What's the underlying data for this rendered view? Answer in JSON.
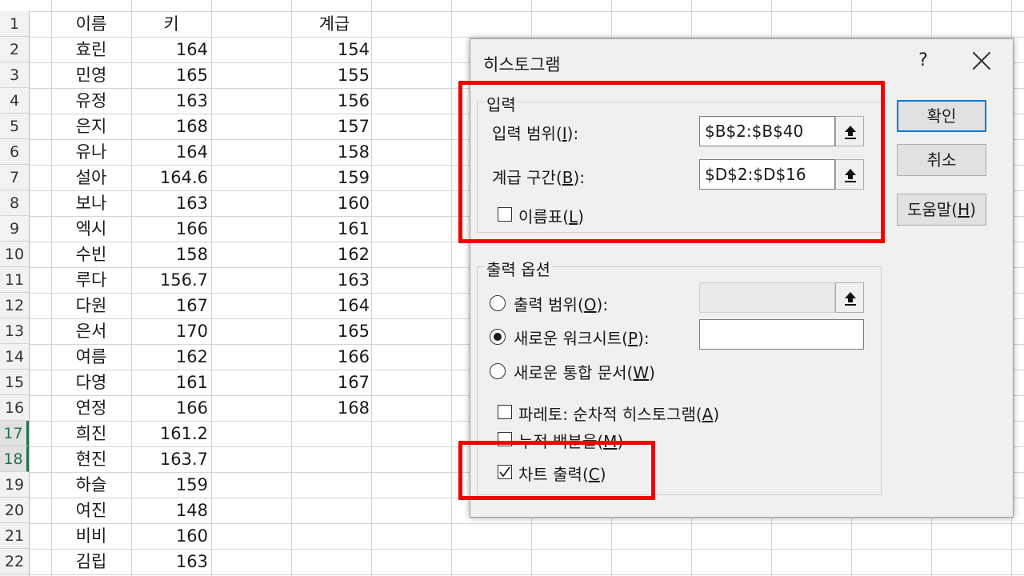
{
  "sheet": {
    "headers": {
      "name": "이름",
      "height": "키",
      "bin": "계급"
    },
    "row_numbers": [
      "1",
      "2",
      "3",
      "4",
      "5",
      "6",
      "7",
      "8",
      "9",
      "10",
      "11",
      "12",
      "13",
      "14",
      "15",
      "16",
      "17",
      "18",
      "19",
      "20",
      "21",
      "22"
    ],
    "names": [
      "효린",
      "민영",
      "유정",
      "은지",
      "유나",
      "설아",
      "보나",
      "엑시",
      "수빈",
      "루다",
      "다원",
      "은서",
      "여름",
      "다영",
      "연정",
      "희진",
      "현진",
      "하슬",
      "여진",
      "비비",
      "김립"
    ],
    "heights": [
      "164",
      "165",
      "163",
      "168",
      "164",
      "164.6",
      "163",
      "166",
      "158",
      "156.7",
      "167",
      "170",
      "162",
      "161",
      "166",
      "161.2",
      "163.7",
      "159",
      "148",
      "160",
      "163"
    ],
    "bins": [
      "154",
      "155",
      "156",
      "157",
      "158",
      "159",
      "160",
      "161",
      "162",
      "163",
      "164",
      "165",
      "166",
      "167",
      "168"
    ]
  },
  "dialog": {
    "title": "히스토그램",
    "help": "?",
    "input_group": {
      "label": "입력",
      "input_range_label": "입력 범위(I):",
      "input_range_value": "$B$2:$B$40",
      "bin_range_label": "계급 구간(B):",
      "bin_range_value": "$D$2:$D$16",
      "labels_checkbox": "이름표(L)"
    },
    "output_group": {
      "label": "출력 옵션",
      "output_range": "출력 범위(O):",
      "new_worksheet": "새로운 워크시트(P):",
      "new_workbook": "새로운 통합 문서(W)",
      "pareto": "파레토: 순차적 히스토그램(A)",
      "cumulative": "누적 백분율(M)",
      "chart_output": "차트 출력(C)",
      "selected_output": "new_worksheet"
    },
    "buttons": {
      "ok": "확인",
      "cancel": "취소",
      "help": "도움말(H)"
    },
    "checked": {
      "labels": false,
      "pareto": false,
      "cumulative": false,
      "chart_output": true
    }
  },
  "colors": {
    "highlight": "#f00000",
    "excel_green": "#217346",
    "default_button_border": "#0078d7"
  },
  "icons": {
    "collapse_dialog": "upload-arrow-icon",
    "close": "close-icon",
    "checkmark": "checkmark-icon"
  }
}
